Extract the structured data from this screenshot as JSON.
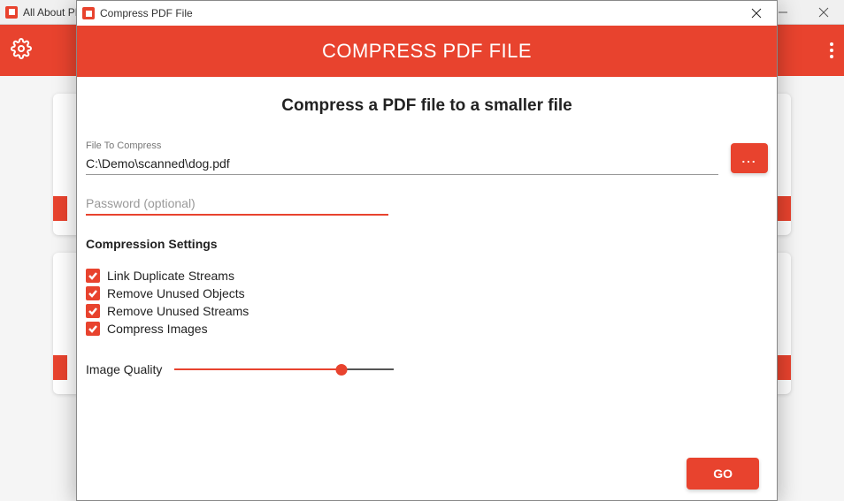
{
  "background": {
    "title": "All About PDF",
    "toolbar": {
      "gear": "settings",
      "more": "more"
    }
  },
  "dialog": {
    "title": "Compress PDF File",
    "banner": "COMPRESS PDF FILE",
    "subtitle": "Compress a PDF file to a smaller file",
    "fileField": {
      "label": "File To Compress",
      "value": "C:\\Demo\\scanned\\dog.pdf"
    },
    "browseBtn": "...",
    "passwordField": {
      "placeholder": "Password (optional)",
      "value": ""
    },
    "settingsTitle": "Compression Settings",
    "checks": [
      {
        "label": "Link Duplicate Streams",
        "checked": true
      },
      {
        "label": "Remove Unused Objects",
        "checked": true
      },
      {
        "label": "Remove Unused Streams",
        "checked": true
      },
      {
        "label": "Compress Images",
        "checked": true
      }
    ],
    "slider": {
      "label": "Image Quality",
      "value": 76,
      "min": 0,
      "max": 100
    },
    "goBtn": "GO"
  },
  "colors": {
    "accent": "#e8432e"
  }
}
